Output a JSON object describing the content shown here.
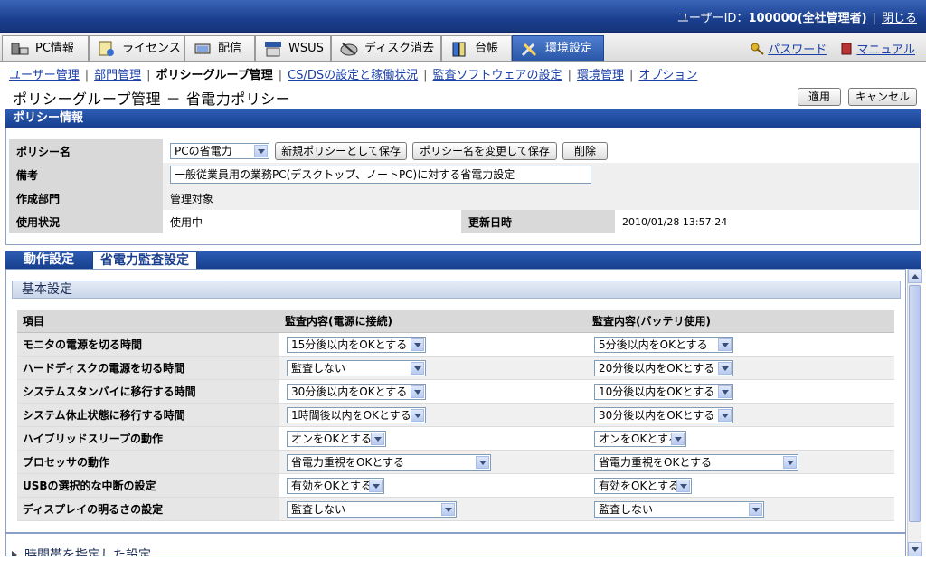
{
  "header": {
    "user_label": "ユーザーID：",
    "user_value": "100000(全社管理者)",
    "close_label": "閉じる"
  },
  "tabs": [
    {
      "label": "PC情報",
      "icon": "pc-icon"
    },
    {
      "label": "ライセンス",
      "icon": "license-icon"
    },
    {
      "label": "配信",
      "icon": "distribution-icon"
    },
    {
      "label": "WSUS",
      "icon": "wsus-icon"
    },
    {
      "label": "ディスク消去",
      "icon": "disk-erase-icon"
    },
    {
      "label": "台帳",
      "icon": "ledger-icon"
    },
    {
      "label": "環境設定",
      "icon": "tools-icon",
      "active": true
    }
  ],
  "right_links": {
    "password": "パスワード",
    "manual": "マニュアル"
  },
  "subnav": {
    "items": [
      "ユーザー管理",
      "部門管理",
      "ポリシーグループ管理",
      "CS/DSの設定と稼働状況",
      "監査ソフトウェアの設定",
      "環境管理",
      "オプション"
    ],
    "current_index": 2
  },
  "page": {
    "title": "ポリシーグループ管理 － 省電力ポリシー",
    "apply_label": "適用",
    "cancel_label": "キャンセル"
  },
  "policy_info": {
    "section_title": "ポリシー情報",
    "name_label": "ポリシー名",
    "name_value": "PCの省電力",
    "save_new_label": "新規ポリシーとして保存",
    "rename_label": "ポリシー名を変更して保存",
    "delete_label": "削除",
    "note_label": "備考",
    "note_value": "一般従業員用の業務PC(デスクトップ、ノートPC)に対する省電力設定",
    "dept_label": "作成部門",
    "dept_value": "管理対象",
    "status_label": "使用状況",
    "status_value": "使用中",
    "updated_label": "更新日時",
    "updated_value": "2010/01/28 13:57:24"
  },
  "lower_tabs": [
    "動作設定",
    "省電力監査設定"
  ],
  "basic": {
    "title": "基本設定",
    "headers": [
      "項目",
      "監査内容(電源に接続)",
      "監査内容(バッテリ使用)"
    ],
    "rows": [
      {
        "item": "モニタの電源を切る時間",
        "ac": "15分後以内をOKとする",
        "dc": "5分後以内をOKとする"
      },
      {
        "item": "ハードディスクの電源を切る時間",
        "ac": "監査しない",
        "dc": "20分後以内をOKとする"
      },
      {
        "item": "システムスタンバイに移行する時間",
        "ac": "30分後以内をOKとする",
        "dc": "10分後以内をOKとする"
      },
      {
        "item": "システム休止状態に移行する時間",
        "ac": "1時間後以内をOKとする",
        "dc": "30分後以内をOKとする"
      },
      {
        "item": "ハイブリッドスリープの動作",
        "ac": "オンをOKとする",
        "dc": "オンをOKとする"
      },
      {
        "item": "プロセッサの動作",
        "ac": "省電力重視をOKとする",
        "dc": "省電力重視をOKとする"
      },
      {
        "item": "USBの選択的な中断の設定",
        "ac": "有効をOKとする",
        "dc": "有効をOKとする"
      },
      {
        "item": "ディスプレイの明るさの設定",
        "ac": "監査しない",
        "dc": "監査しない"
      }
    ]
  },
  "time_section_label": "時間帯を指定した設定"
}
